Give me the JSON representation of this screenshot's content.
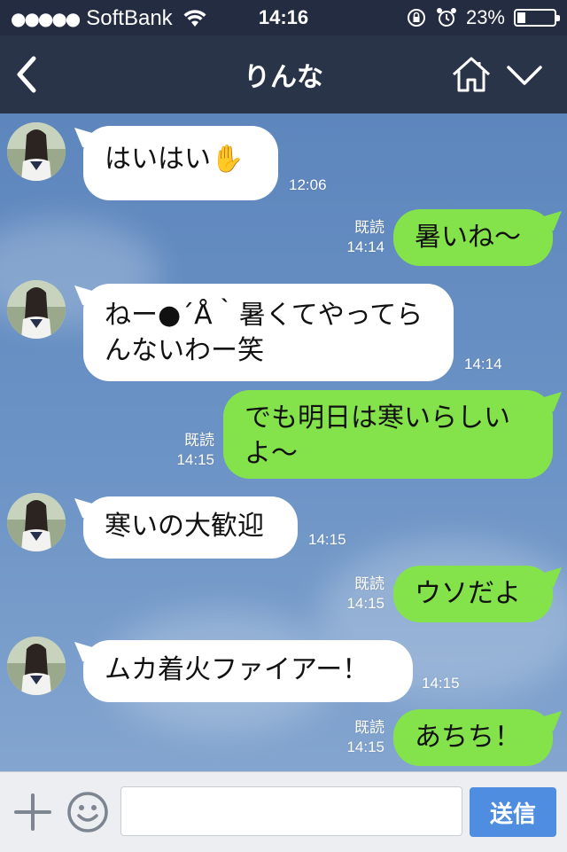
{
  "status_bar": {
    "signal_dots": "●●●●●",
    "carrier": "SoftBank",
    "time": "14:16",
    "battery": "23%",
    "battery_level": 0.23
  },
  "header": {
    "title": "りんな",
    "color": "#2a3448"
  },
  "messages": [
    {
      "side": "in",
      "text": "はいはい✋",
      "time": "12:06"
    },
    {
      "side": "out",
      "text": "暑いね〜",
      "read": "既読",
      "time": "14:14"
    },
    {
      "side": "in",
      "text": "ねー●´Å｀暑くてやってらんないわー笑",
      "time": "14:14"
    },
    {
      "side": "out",
      "text": "でも明日は寒いらしいよ〜",
      "read": "既読",
      "time": "14:15"
    },
    {
      "side": "in",
      "text": "寒いの大歓迎",
      "time": "14:15"
    },
    {
      "side": "out",
      "text": "ウソだよ",
      "read": "既読",
      "time": "14:15"
    },
    {
      "side": "in",
      "text": "ムカ着火ファイアー！",
      "time": "14:15"
    },
    {
      "side": "out",
      "text": "あちち！",
      "read": "既読",
      "time": "14:15"
    }
  ],
  "input": {
    "placeholder": "",
    "send_label": "送信"
  },
  "colors": {
    "incoming_bubble": "#ffffff",
    "outgoing_bubble": "#84e34a",
    "send_button": "#4e8de0"
  }
}
